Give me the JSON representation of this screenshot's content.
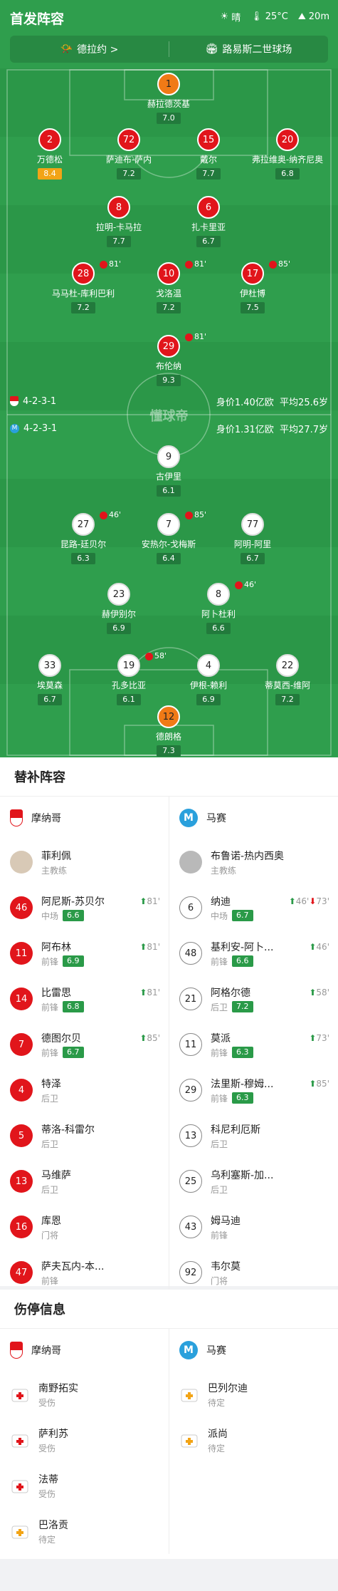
{
  "header": {
    "title": "首发阵容",
    "weather": "晴",
    "temp": "25°C",
    "wind": "20m"
  },
  "info": {
    "referee": "德拉约 >",
    "stadium": "路易斯二世球场"
  },
  "home_formation": {
    "formation": "4-2-3-1",
    "value": "身价1.40亿欧",
    "age": "平均25.6岁"
  },
  "away_formation": {
    "formation": "4-2-3-1",
    "value": "身价1.31亿欧",
    "age": "平均27.7岁"
  },
  "watermark": "懂球帝",
  "home_players": [
    {
      "num": "1",
      "name": "赫拉德茨基",
      "rating": "7.0",
      "gk": true,
      "yc": true
    },
    {
      "num": "2",
      "name": "万德松",
      "rating": "8.4",
      "best": true
    },
    {
      "num": "72",
      "name": "萨迪布-萨内",
      "rating": "7.2"
    },
    {
      "num": "15",
      "name": "戴尔",
      "rating": "7.7"
    },
    {
      "num": "20",
      "name": "弗拉维奥-纳齐尼奥",
      "rating": "6.8",
      "yc": true
    },
    {
      "num": "8",
      "name": "拉明-卡马拉",
      "rating": "7.7",
      "yc": true
    },
    {
      "num": "6",
      "name": "扎卡里亚",
      "rating": "6.7",
      "yc": true
    },
    {
      "num": "28",
      "name": "马马杜-库利巴利",
      "rating": "7.2",
      "ev": "81'"
    },
    {
      "num": "10",
      "name": "戈洛温",
      "rating": "7.2",
      "ev": "81'"
    },
    {
      "num": "17",
      "name": "伊杜博",
      "rating": "7.5",
      "ev": "85'"
    },
    {
      "num": "29",
      "name": "布伦纳",
      "rating": "9.3",
      "ev": "81'"
    }
  ],
  "away_players": [
    {
      "num": "9",
      "name": "古伊里",
      "rating": "6.1"
    },
    {
      "num": "27",
      "name": "昆路-廷贝尔",
      "rating": "6.3",
      "ev": "46'"
    },
    {
      "num": "7",
      "name": "安热尔-戈梅斯",
      "rating": "6.4",
      "ev": "85'"
    },
    {
      "num": "77",
      "name": "阿明-阿里",
      "rating": "6.7"
    },
    {
      "num": "23",
      "name": "赫伊别尔",
      "rating": "6.9"
    },
    {
      "num": "8",
      "name": "阿卜杜利",
      "rating": "6.6",
      "ev": "46'"
    },
    {
      "num": "33",
      "name": "埃莫森",
      "rating": "6.7"
    },
    {
      "num": "19",
      "name": "孔多比亚",
      "rating": "6.1",
      "ev": "58'"
    },
    {
      "num": "4",
      "name": "伊根-赖利",
      "rating": "6.9"
    },
    {
      "num": "22",
      "name": "蒂莫西-维阿",
      "rating": "7.2"
    },
    {
      "num": "12",
      "name": "德朗格",
      "rating": "7.3",
      "gk": true
    }
  ],
  "subs": {
    "title": "替补阵容",
    "home_team": "摩纳哥",
    "away_team": "马赛",
    "home_coach": {
      "name": "菲利佩",
      "role": "主教练"
    },
    "away_coach": {
      "name": "布鲁诺-热内西奥",
      "role": "主教练"
    },
    "home": [
      {
        "num": "46",
        "name": "阿尼斯-苏贝尔",
        "pos": "中场",
        "rating": "6.6",
        "sub": "81'"
      },
      {
        "num": "11",
        "name": "阿布林",
        "pos": "前锋",
        "rating": "6.9",
        "sub": "81'"
      },
      {
        "num": "14",
        "name": "比雷思",
        "pos": "前锋",
        "rating": "6.8",
        "sub": "81'"
      },
      {
        "num": "7",
        "name": "德图尔贝",
        "pos": "前锋",
        "rating": "6.7",
        "sub": "85'"
      },
      {
        "num": "4",
        "name": "特泽",
        "pos": "后卫"
      },
      {
        "num": "5",
        "name": "蒂洛-科雷尔",
        "pos": "后卫"
      },
      {
        "num": "13",
        "name": "马维萨",
        "pos": "后卫"
      },
      {
        "num": "16",
        "name": "库恩",
        "pos": "门将"
      },
      {
        "num": "47",
        "name": "萨夫瓦内-本...",
        "pos": "前锋"
      }
    ],
    "away": [
      {
        "num": "6",
        "name": "纳迪",
        "pos": "中场",
        "rating": "6.7",
        "sub": "46'",
        "sub2": "73'"
      },
      {
        "num": "48",
        "name": "基利安-阿卜...",
        "pos": "前锋",
        "rating": "6.6",
        "sub": "46'"
      },
      {
        "num": "21",
        "name": "阿格尔德",
        "pos": "后卫",
        "rating": "7.2",
        "sub": "58'"
      },
      {
        "num": "11",
        "name": "莫派",
        "pos": "前锋",
        "rating": "6.3",
        "sub": "73'"
      },
      {
        "num": "29",
        "name": "法里斯-穆姆...",
        "pos": "前锋",
        "rating": "6.3",
        "sub": "85'"
      },
      {
        "num": "13",
        "name": "科尼利厄斯",
        "pos": "后卫"
      },
      {
        "num": "25",
        "name": "乌利塞斯-加...",
        "pos": "后卫"
      },
      {
        "num": "43",
        "name": "姆马迪",
        "pos": "前锋"
      },
      {
        "num": "92",
        "name": "韦尔莫",
        "pos": "门将"
      }
    ]
  },
  "injuries": {
    "title": "伤停信息",
    "home_team": "摩纳哥",
    "away_team": "马赛",
    "home": [
      {
        "name": "南野拓实",
        "status": "受伤",
        "type": "injured"
      },
      {
        "name": "萨利苏",
        "status": "受伤",
        "type": "injured"
      },
      {
        "name": "法蒂",
        "status": "受伤",
        "type": "injured"
      },
      {
        "name": "巴洛贡",
        "status": "待定",
        "type": "doubt"
      }
    ],
    "away": [
      {
        "name": "巴列尔迪",
        "status": "待定",
        "type": "doubt"
      },
      {
        "name": "派尚",
        "status": "待定",
        "type": "doubt"
      }
    ]
  },
  "colors": {
    "pitch": "#2f9e4d",
    "home": "#e1151b",
    "rating": "#227a3c",
    "best": "#f2a416"
  }
}
